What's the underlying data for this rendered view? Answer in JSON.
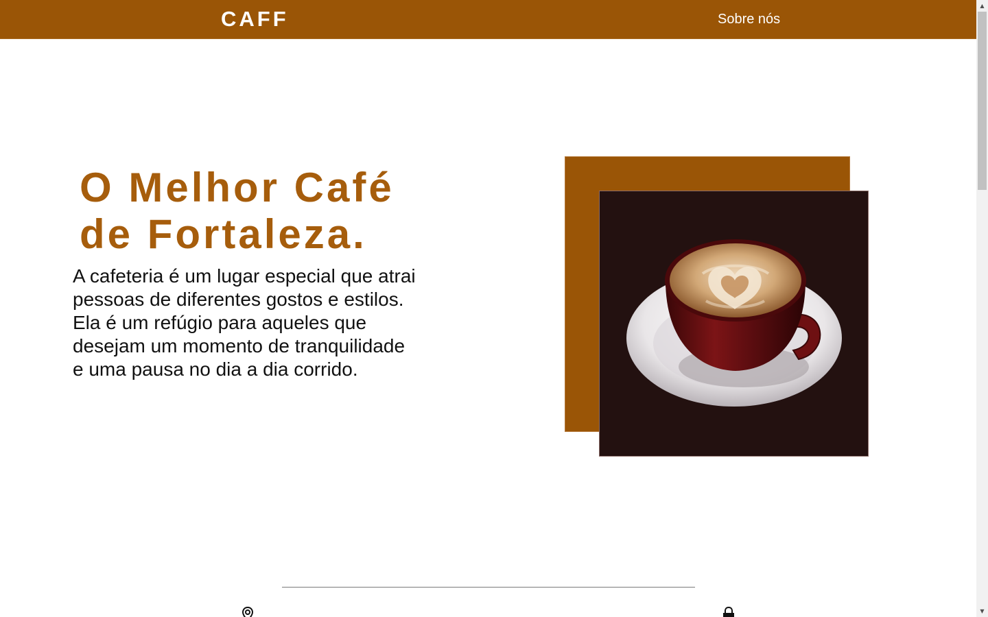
{
  "header": {
    "brand": "CAFF",
    "nav_link": "Sobre nós"
  },
  "hero": {
    "title": "O Melhor Café de Fortaleza.",
    "description": "A cafeteria é um lugar especial que atrai pessoas de diferentes gostos e estilos. Ela é um refúgio para aqueles que desejam um momento de tranquilidade e uma pausa no dia a dia corrido.",
    "image_alt": "cappuccino-cup-image"
  },
  "footer": {
    "icons": [
      "location-pin-icon",
      "lock-icon"
    ]
  },
  "colors": {
    "brand": "#9a5506",
    "title": "#a65d0c",
    "image_bg": "#231110"
  },
  "scrollbar": {
    "up_arrow": "▲",
    "down_arrow": "▼"
  }
}
